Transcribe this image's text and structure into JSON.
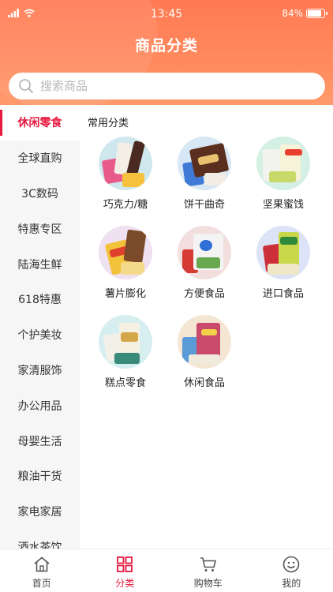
{
  "status": {
    "time": "13:45",
    "battery": "84%",
    "battery_level": 0.84
  },
  "header": {
    "title": "商品分类"
  },
  "search": {
    "placeholder": "搜索商品"
  },
  "sidebar": {
    "items": [
      {
        "label": "休闲零食"
      },
      {
        "label": "全球直购"
      },
      {
        "label": "3C数码"
      },
      {
        "label": "特惠专区"
      },
      {
        "label": "陆海生鲜"
      },
      {
        "label": "618特惠"
      },
      {
        "label": "个护美妆"
      },
      {
        "label": "家清服饰"
      },
      {
        "label": "办公用品"
      },
      {
        "label": "母婴生活"
      },
      {
        "label": "粮油干货"
      },
      {
        "label": "家电家居"
      },
      {
        "label": "酒水茶饮"
      }
    ]
  },
  "content": {
    "section_title": "常用分类",
    "categories": [
      {
        "label": "巧克力/糖",
        "icon": "chocolate-candy-image"
      },
      {
        "label": "饼干曲奇",
        "icon": "biscuit-cookie-image"
      },
      {
        "label": "坚果蜜饯",
        "icon": "nuts-dried-fruit-image"
      },
      {
        "label": "薯片膨化",
        "icon": "chips-puffed-snack-image"
      },
      {
        "label": "方便食品",
        "icon": "instant-food-image"
      },
      {
        "label": "进口食品",
        "icon": "imported-food-image"
      },
      {
        "label": "糕点零食",
        "icon": "pastry-snack-image"
      },
      {
        "label": "休闲食品",
        "icon": "leisure-food-image"
      }
    ]
  },
  "tabbar": {
    "items": [
      {
        "label": "首页",
        "icon": "home-icon"
      },
      {
        "label": "分类",
        "icon": "category-grid-icon"
      },
      {
        "label": "购物车",
        "icon": "cart-icon"
      },
      {
        "label": "我的",
        "icon": "smile-profile-icon"
      }
    ]
  },
  "colors": {
    "accent": "#e8183f",
    "header": "#ff7f56",
    "sidebar_bg": "#f6f6f6"
  }
}
